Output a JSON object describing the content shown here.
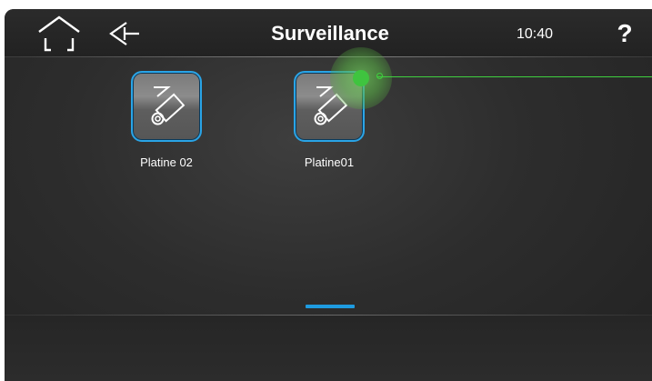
{
  "header": {
    "title": "Surveillance",
    "time": "10:40",
    "help_label": "?"
  },
  "icons": {
    "home": "home-icon",
    "back": "back-arrow-icon",
    "camera": "camera-icon"
  },
  "tiles": [
    {
      "label": "Platine 02",
      "icon": "camera-icon"
    },
    {
      "label": "Platine01",
      "icon": "camera-icon"
    }
  ],
  "pager": {
    "current_page": 1,
    "total_pages": 1
  },
  "colors": {
    "accent": "#2aa4e6",
    "touch_indicator": "#3fc43f",
    "background": "#2d2d2d",
    "text": "#ffffff"
  }
}
